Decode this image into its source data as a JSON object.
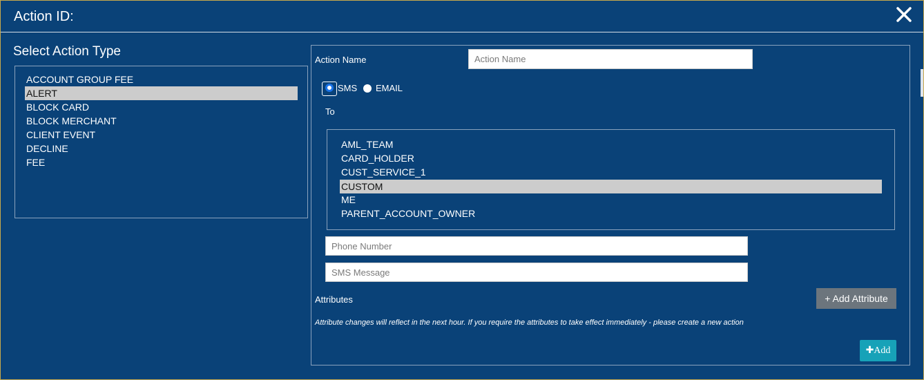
{
  "dialog": {
    "title": "Action ID:"
  },
  "action_type": {
    "heading": "Select Action Type",
    "items": [
      "ACCOUNT GROUP FEE",
      "ALERT",
      "BLOCK CARD",
      "BLOCK MERCHANT",
      "CLIENT EVENT",
      "DECLINE",
      "FEE"
    ],
    "selected": "ALERT"
  },
  "form": {
    "action_name_label": "Action Name",
    "action_name_placeholder": "Action Name",
    "action_name_value": "",
    "channel": {
      "sms_label": "SMS",
      "email_label": "EMAIL",
      "selected": "SMS"
    },
    "to_label": "To",
    "recipients": [
      "AML_TEAM",
      "CARD_HOLDER",
      "CUST_SERVICE_1",
      "CUSTOM",
      "ME",
      "PARENT_ACCOUNT_OWNER"
    ],
    "recipient_selected": "CUSTOM",
    "phone_placeholder": "Phone Number",
    "sms_placeholder": "SMS Message",
    "attributes_label": "Attributes",
    "add_attribute_label": "+ Add Attribute",
    "note": "Attribute changes will reflect in the next hour. If you require the attributes to take effect immediately - please create a new action",
    "add_label": "Add"
  },
  "colors": {
    "background": "#0a4278",
    "selected_row": "#cccccc",
    "secondary_button": "#6c757d",
    "accent_button": "#17a2b8"
  }
}
